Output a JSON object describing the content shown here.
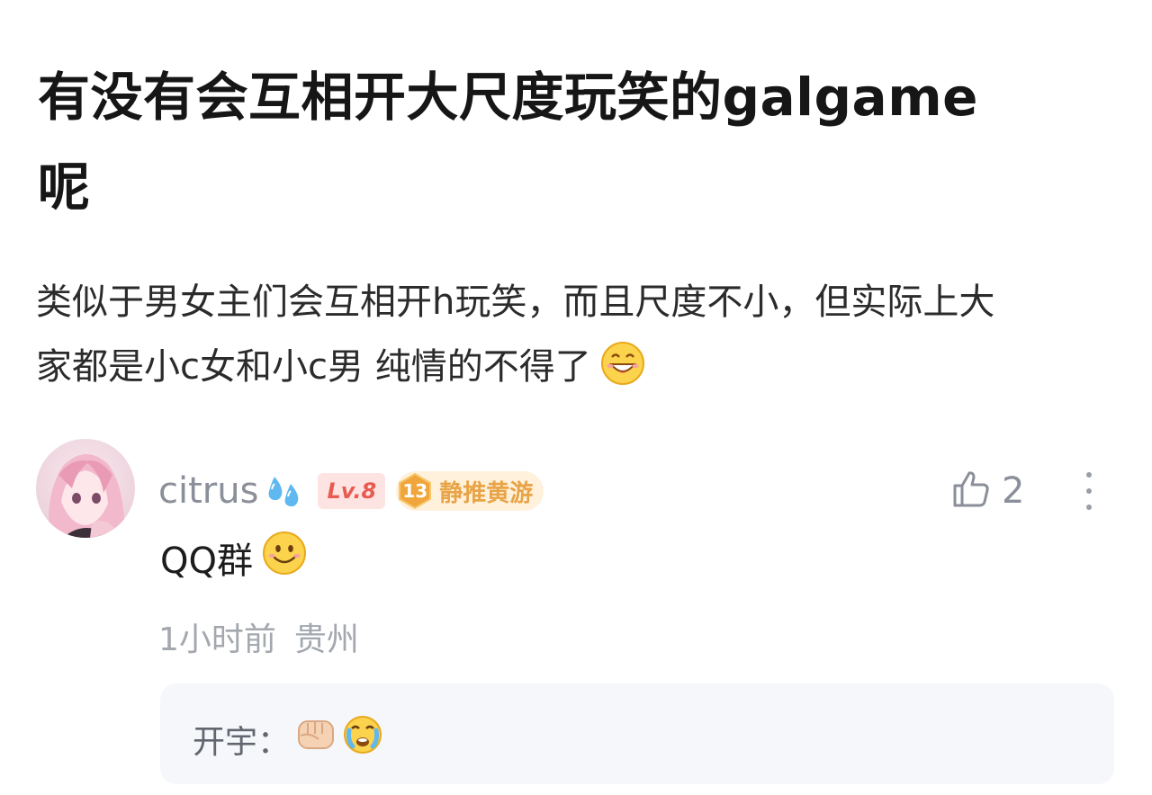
{
  "post": {
    "title_line1": "有没有会互相开大尺度玩笑的galgame",
    "title_line2": "呢",
    "body_line1": "类似于男女主们会互相开h玩笑，而且尺度不小，但实际上大",
    "body_line2": "家都是小c女和小c男 纯情的不得了",
    "body_emoji": "grinning-face-emoji"
  },
  "comment": {
    "username": "citrus",
    "username_icon": "sweat-drops-icon",
    "level": "Lv.8",
    "fan_badge_level": "13",
    "fan_badge_name": "静推黄游",
    "like_count": "2",
    "text": "QQ群",
    "text_emoji": "smiling-face-emoji",
    "time": "1小时前",
    "location": "贵州",
    "reply": {
      "author": "开宇",
      "separator": "：",
      "emojis": [
        "fist-icon",
        "crying-face-icon"
      ]
    }
  },
  "colors": {
    "level_badge_bg": "#fde4e2",
    "level_badge_text": "#e85b50",
    "fan_badge_bg": "#fff1dc",
    "fan_badge_text": "#e8a447",
    "username": "#8a8f99",
    "reply_bg": "#f6f7fb"
  }
}
